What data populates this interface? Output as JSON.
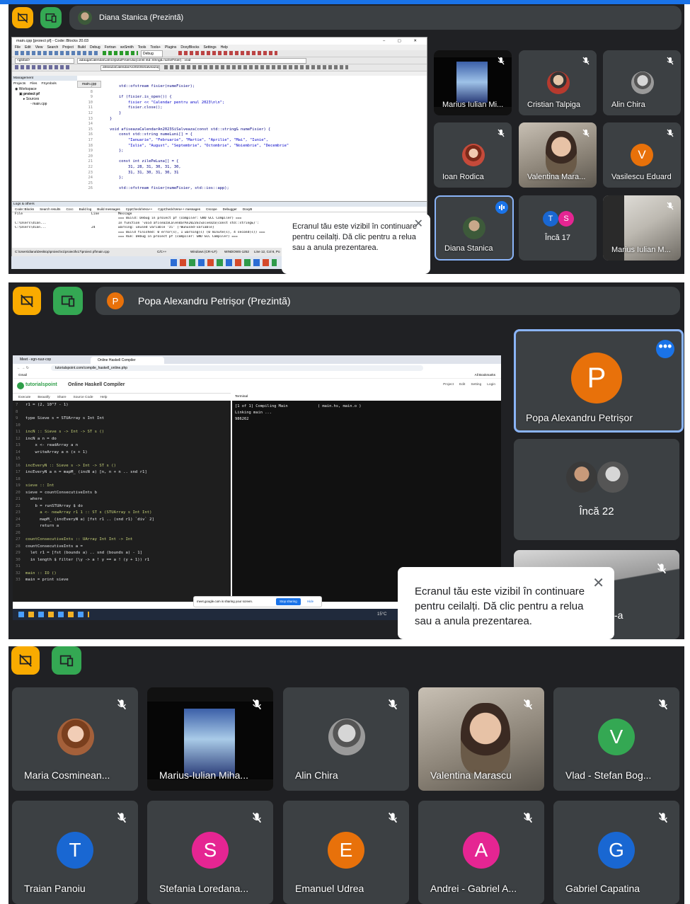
{
  "panel1": {
    "presenter_title": "Diana Stanica (Prezintă)",
    "ide": {
      "window_title": "main.cpp [proiect pf] - Code::Blocks 20.03",
      "menu": [
        "File",
        "Edit",
        "View",
        "Search",
        "Project",
        "Build",
        "Debug",
        "Fortran",
        "wxSmith",
        "Tools",
        "Tools+",
        "Plugins",
        "DoxyBlocks",
        "Settings",
        "Help"
      ],
      "build_target": "Debug",
      "scope_combo": "<global>",
      "function_combo": "adaugaCalendarLaInceputulFisierului(const std::string& numeFisier) : void",
      "function_combo2": "afiseazaCalendarAn2023SiSalveaza(const std::string& numeFisier) : void",
      "mgmt_title": "Management",
      "mgmt_tabs": [
        "Projects",
        "Files",
        "FSymbols"
      ],
      "tree": [
        "Workspace",
        "proiect pf",
        "Sources",
        "main.cpp"
      ],
      "editor_tab": "main.cpp",
      "line_numbers": [
        "7",
        "8",
        "9",
        "10",
        "11",
        "12",
        "13",
        "14",
        "15",
        "16",
        "17",
        "18",
        "19",
        "20",
        "21",
        "22",
        "23",
        "24",
        "25",
        "26"
      ],
      "code": [
        "    std::ofstream fisier(numeFisier);",
        "",
        "    if (fisier.is_open()) {",
        "        fisier << \"Calendar pentru anul 2023\\n\\n\";",
        "        fisier.close();",
        "    }",
        "}",
        "",
        "void afiseazaCalendarAn2023SiSalveaza(const std::string& numeFisier) {",
        "    const std::string numeLuni[] = {",
        "        \"Ianuarie\", \"Februarie\", \"Martie\", \"Aprilie\", \"Mai\", \"Iunie\",",
        "        \"Iulie\", \"August\", \"Septembrie\", \"Octombrie\", \"Noiembrie\", \"Decembrie\"",
        "    };",
        "",
        "    const int zilePeLuna[] = {",
        "        31, 28, 31, 30, 31, 30,",
        "        31, 31, 30, 31, 30, 31",
        "    };",
        "",
        "    std::ofstream fisier(numeFisier, std::ios::app);"
      ],
      "logs_title": "Logs & others",
      "log_tabs": [
        "Code::Blocks",
        "Search results",
        "Cccc",
        "Build log",
        "Build messages",
        "CppCheck/Vera++",
        "CppCheck/Vera++ messages",
        "Cscope",
        "Debugger",
        "DoxyB"
      ],
      "log_headers": [
        "File",
        "Line",
        "Message"
      ],
      "log_rows": [
        [
          "",
          "",
          "=== Build: Debug in proiect pf (compiler: GNU GCC Compiler) ==="
        ],
        [
          "C:\\Users\\dian...",
          "",
          "In function 'void afiseazaCalendarAn2023SiSalveaza(const std::string&)':"
        ],
        [
          "C:\\Users\\dian...",
          "24",
          "warning: unused variable 'zi' [-Wunused-variable]"
        ],
        [
          "",
          "",
          "=== Build finished: 0 error(s), 1 warning(s) (0 minute(s), 4 second(s)) ==="
        ],
        [
          "",
          "",
          "=== Run: Debug in proiect pf (compiler: GNU GCC Compiler) ==="
        ]
      ],
      "status_path": "C:\\Users\\diana\\Desktop\\proiect\\v1\\proiectfv17\\proiect pf\\main.cpp",
      "status_lang": "C/C++",
      "status_eol": "Windows (CR+LF)",
      "status_enc": "WINDOWS-1252",
      "status_pos": "Line 12, Col 6, Po"
    },
    "toast": "Ecranul tău este vizibil în continuare pentru ceilalți. Dă clic pentru a relua sau a anula prezentarea.",
    "tiles": [
      {
        "name": "Marius Iulian Mi..."
      },
      {
        "name": "Cristian Talpiga"
      },
      {
        "name": "Alin Chira"
      },
      {
        "name": "Ioan Rodica"
      },
      {
        "name": "Valentina Mara..."
      },
      {
        "name": "Vasilescu Eduard",
        "initial": "V"
      },
      {
        "name": "Diana Stanica"
      },
      {
        "name": "Încă 17",
        "initials": [
          "T",
          "S"
        ]
      },
      {
        "name": "Marius Iulian M..."
      }
    ]
  },
  "panel2": {
    "presenter_initial": "P",
    "presenter_title": "Popa Alexandru Petrișor (Prezintă)",
    "browser": {
      "tab1": "Meet - egn-ruur-cop",
      "tab2": "Online Haskell Compiler",
      "url": "tutorialspoint.com/compile_haskell_online.php",
      "bookmark1": "Gmail",
      "bookmarks_all": "All Bookmarks",
      "brand": "tutorialspoint",
      "page_title": "Online Haskell Compiler",
      "menu_right": [
        "Project",
        "Edit",
        "Setting",
        "Login"
      ],
      "toolbar": [
        "Execute",
        "Beautify",
        "Share",
        "Source Code",
        "Help"
      ],
      "terminal_label": "Terminal",
      "code_lines": [
        [
          "7",
          "r1 = (2, 10^7 - 1)"
        ],
        [
          "8",
          ""
        ],
        [
          "9",
          "type Sieve s = STUArray s Int Int"
        ],
        [
          "10",
          ""
        ],
        [
          "11",
          "incN :: Sieve s -> Int -> ST s ()"
        ],
        [
          "12",
          "incN a n = do"
        ],
        [
          "13",
          "    x <- readArray a n"
        ],
        [
          "14",
          "    writeArray a n (x + 1)"
        ],
        [
          "15",
          ""
        ],
        [
          "16",
          "incEveryN :: Sieve s -> Int -> ST s ()"
        ],
        [
          "17",
          "incEveryN a n = mapM_ (incN a) [n, n + n .. snd r1]"
        ],
        [
          "18",
          ""
        ],
        [
          "19",
          "sieve :: Int"
        ],
        [
          "20",
          "sieve = countConsecutiveInts b"
        ],
        [
          "21",
          "  where"
        ],
        [
          "22",
          "    b = runSTUArray $ do"
        ],
        [
          "23",
          "      a <- newArray r1 1 :: ST s (STUArray s Int Int)"
        ],
        [
          "24",
          "      mapM_ (incEveryN a) [fst r1 .. (snd r1) `div` 2]"
        ],
        [
          "25",
          "      return a"
        ],
        [
          "26",
          ""
        ],
        [
          "27",
          "countConsecutiveInts :: UArray Int Int -> Int"
        ],
        [
          "28",
          "countConsecutiveInts a ="
        ],
        [
          "29",
          "  let r1 = [fst (bounds a) .. snd (bounds a) - 1]"
        ],
        [
          "30",
          "  in length $ filter (\\y -> a ! y == a ! (y + 1)) r1"
        ],
        [
          "31",
          ""
        ],
        [
          "32",
          "main :: IO ()"
        ],
        [
          "33",
          "main = print sieve"
        ]
      ],
      "terminal_lines": [
        "[1 of 1] Compiling Main             ( main.hs, main.o )",
        "Linking main ...",
        "986262"
      ],
      "share_notice": "meet.google.com is sharing your screen.",
      "stop_sharing": "Stop sharing",
      "hide": "Hide",
      "weather": "15°C"
    },
    "presenter_tile_name": "Popa Alexandru Petrișor",
    "presenter_tile_initial": "P",
    "more_tile_name": "Încă 22",
    "toast": "Ecranul tău este vizibil în continuare pentru ceilalți. Dă clic pentru a relua sau a anula prezentarea.",
    "partial_tile_suffix": "-a"
  },
  "panel3": {
    "tiles": [
      {
        "name": "Maria Cosminean..."
      },
      {
        "name": "Marius-Iulian Miha..."
      },
      {
        "name": "Alin Chira"
      },
      {
        "name": "Valentina Marascu"
      },
      {
        "name": "Vlad - Stefan Bog...",
        "initial": "V"
      },
      {
        "name": "Traian Panoiu",
        "initial": "T"
      },
      {
        "name": "Stefania Loredana...",
        "initial": "S"
      },
      {
        "name": "Emanuel Udrea",
        "initial": "E"
      },
      {
        "name": "Andrei - Gabriel A...",
        "initial": "A"
      },
      {
        "name": "Gabriel Capatina",
        "initial": "G"
      }
    ]
  },
  "colors": {
    "meet_bg": "#202124",
    "tile_bg": "#3c4043",
    "yellow_button": "#f9ab00",
    "green_button": "#34a853",
    "active_border": "#8ab4f8",
    "speaking_blue": "#1a73e8",
    "avatar_orange": "#e8710a",
    "avatar_green": "#34a853",
    "avatar_blue": "#1967d2",
    "avatar_pink": "#e52592",
    "top_accent": "#1a73e8"
  }
}
